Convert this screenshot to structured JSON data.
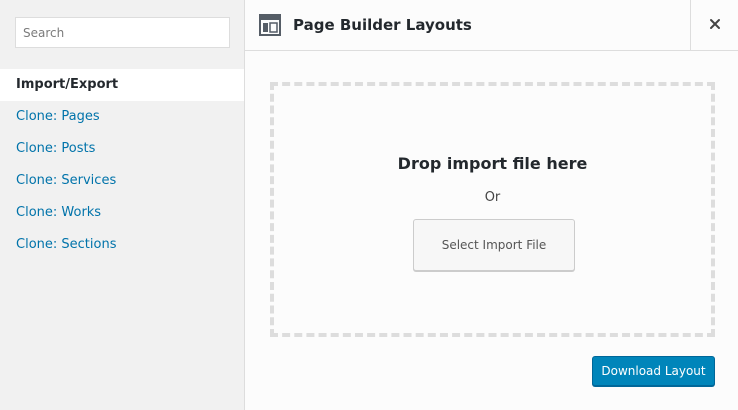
{
  "sidebar": {
    "search": {
      "placeholder": "Search",
      "value": ""
    },
    "items": [
      {
        "label": "Import/Export",
        "active": true
      },
      {
        "label": "Clone: Pages",
        "active": false
      },
      {
        "label": "Clone: Posts",
        "active": false
      },
      {
        "label": "Clone: Services",
        "active": false
      },
      {
        "label": "Clone: Works",
        "active": false
      },
      {
        "label": "Clone: Sections",
        "active": false
      }
    ]
  },
  "header": {
    "title": "Page Builder Layouts",
    "icon": "layout-icon",
    "close_icon": "close-icon"
  },
  "import": {
    "drop_title": "Drop import file here",
    "or_text": "Or",
    "select_button": "Select Import File"
  },
  "actions": {
    "download_button": "Download Layout"
  },
  "colors": {
    "accent": "#0085ba",
    "link": "#0073aa",
    "sidebar_bg": "#f1f1f1",
    "border": "#dddddd"
  }
}
